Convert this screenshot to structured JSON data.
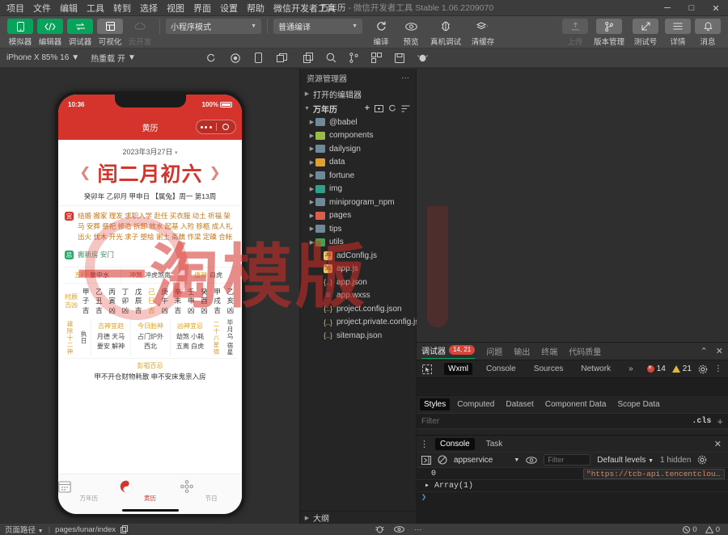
{
  "titlebar": {
    "menu": [
      "项目",
      "文件",
      "编辑",
      "工具",
      "转到",
      "选择",
      "视图",
      "界面",
      "设置",
      "帮助",
      "微信开发者工具"
    ],
    "project_name": "万年历",
    "app_name": " - 微信开发者工具 Stable 1.06.2209070",
    "minimize": "─",
    "maximize": "□",
    "close": "✕"
  },
  "toolbar": {
    "left_items": [
      {
        "label": "模拟器",
        "icon": "phone-icon",
        "state": "green"
      },
      {
        "label": "编辑器",
        "icon": "code-icon",
        "state": "green"
      },
      {
        "label": "调试器",
        "icon": "debug-icon",
        "state": "green"
      },
      {
        "label": "可视化",
        "icon": "layout-icon",
        "state": "grey"
      },
      {
        "label": "云开发",
        "icon": "cloud-icon",
        "state": "disabled"
      }
    ],
    "mode_select": "小程序模式",
    "compile_select": "普通编译",
    "actions": [
      {
        "label": "编译",
        "icon": "refresh-icon"
      },
      {
        "label": "预览",
        "icon": "eye-icon"
      },
      {
        "label": "真机调试",
        "icon": "device-debug-icon"
      },
      {
        "label": "清缓存",
        "icon": "stack-icon"
      }
    ],
    "right_actions": [
      {
        "label": "上传",
        "icon": "upload-icon",
        "disabled": true
      },
      {
        "label": "版本管理",
        "icon": "branch-icon",
        "disabled": false
      },
      {
        "label": "测试号",
        "icon": "test-icon",
        "disabled": false
      },
      {
        "label": "详情",
        "icon": "menu-icon",
        "disabled": false
      },
      {
        "label": "消息",
        "icon": "bell-icon",
        "disabled": false
      }
    ]
  },
  "subbar": {
    "device": "iPhone X 85% 16",
    "hotreload": "热重载 开",
    "icons": [
      "refresh-icon",
      "record-icon",
      "phone-icon",
      "window-icon"
    ],
    "icons2": [
      "copy-icon",
      "search-icon",
      "branch-icon",
      "extensions-icon",
      "save-icon",
      "debug-icon"
    ]
  },
  "explorer": {
    "title": "资源管理器",
    "more": "···",
    "open_editors": "打开的编辑器",
    "project": "万年历",
    "project_actions": [
      "new-file-icon",
      "new-folder-icon",
      "refresh-icon",
      "collapse-icon"
    ],
    "tree": [
      {
        "name": "@babel",
        "type": "folder",
        "color": "#6e8a9a"
      },
      {
        "name": "components",
        "type": "folder",
        "color": "#9aba4a"
      },
      {
        "name": "dailysign",
        "type": "folder",
        "color": "#6e8a9a"
      },
      {
        "name": "data",
        "type": "folder",
        "color": "#e0a030"
      },
      {
        "name": "fortune",
        "type": "folder",
        "color": "#6e8a9a"
      },
      {
        "name": "img",
        "type": "folder",
        "color": "#2fa08a"
      },
      {
        "name": "miniprogram_npm",
        "type": "folder",
        "color": "#6e8a9a"
      },
      {
        "name": "pages",
        "type": "folder",
        "color": "#d8604a"
      },
      {
        "name": "tips",
        "type": "folder",
        "color": "#6e8a9a"
      },
      {
        "name": "utils",
        "type": "folder",
        "color": "#4aa04a"
      },
      {
        "name": "adConfig.js",
        "type": "js"
      },
      {
        "name": "app.js",
        "type": "js"
      },
      {
        "name": "app.json",
        "type": "json"
      },
      {
        "name": "app.wxss",
        "type": "wxss"
      },
      {
        "name": "project.config.json",
        "type": "json"
      },
      {
        "name": "project.private.config.js...",
        "type": "json"
      },
      {
        "name": "sitemap.json",
        "type": "json"
      }
    ],
    "outline": "大纲"
  },
  "simulator": {
    "status": {
      "time": "10:36",
      "battery": "100%"
    },
    "navbar_title": "黄历",
    "date": "2023年3月27日",
    "date_caret": "▾",
    "prev_arrow": "❮",
    "next_arrow": "❯",
    "lunar_big": "闰二月初六",
    "ganzhi": "癸卯年 乙卯月 甲申日 【属兔】周一 第13周",
    "yi_badge": "宜",
    "yi_text": "结婚 搬家 理发 求职入学 赴任 买衣服 动土 祈福 架马 安葬 祭祀 修造 拆卸 放水 起基 入殓 移柩 成人礼 出火 伐木 开光 求子 塑绘 谢土 斋醮 作梁 定磉 合帐",
    "ji_badge": "忌",
    "ji_text": "搬新房 安门",
    "tri": [
      {
        "label": "五行",
        "value": "泉中水",
        "accent": "gold"
      },
      {
        "label": "冲煞",
        "value": "冲虎煞南",
        "accent": "red"
      },
      {
        "label": "值神",
        "value": "白虎",
        "accent": "gold"
      }
    ],
    "hour_label": [
      "时辰",
      "吉凶"
    ],
    "hours": [
      {
        "g": "甲",
        "z": "子",
        "r": "吉",
        "on": false
      },
      {
        "g": "乙",
        "z": "丑",
        "r": "吉",
        "on": false
      },
      {
        "g": "丙",
        "z": "寅",
        "r": "凶",
        "on": false
      },
      {
        "g": "丁",
        "z": "卯",
        "r": "凶",
        "on": false
      },
      {
        "g": "戊",
        "z": "辰",
        "r": "吉",
        "on": false
      },
      {
        "g": "己",
        "z": "巳",
        "r": "吉",
        "on": true
      },
      {
        "g": "庚",
        "z": "午",
        "r": "凶",
        "on": false
      },
      {
        "g": "辛",
        "z": "未",
        "r": "吉",
        "on": false
      },
      {
        "g": "壬",
        "z": "申",
        "r": "凶",
        "on": false
      },
      {
        "g": "癸",
        "z": "酉",
        "r": "凶",
        "on": false
      },
      {
        "g": "甲",
        "z": "戌",
        "r": "吉",
        "on": false
      },
      {
        "g": "乙",
        "z": "亥",
        "r": "凶",
        "on": false
      }
    ],
    "left_vlabel": "建除十二神",
    "left_vvalue": "执日",
    "gods": [
      {
        "title": "吉神宜趋",
        "body": "月德  天马\n要安  解神"
      },
      {
        "title": "今日胎神",
        "body": "占门炉外\n西北"
      },
      {
        "title": "凶神宜忌",
        "body": "劫煞  小耗\n五离  白虎"
      }
    ],
    "right_vlabel": "二十八星宿",
    "right_vvalue": "毕月乌 宿星",
    "pengzu_title": "彭祖百忌",
    "pengzu_body": "甲不开仓财物耗散 申不安床鬼祟入房",
    "tabs": [
      {
        "label": "万年历",
        "icon": "calendar-icon",
        "active": false
      },
      {
        "label": "黄历",
        "icon": "yinyang-icon",
        "active": true
      },
      {
        "label": "节日",
        "icon": "festival-icon",
        "active": false
      }
    ]
  },
  "devtools": {
    "tabs": [
      {
        "label": "调试器",
        "badge": "14, 21",
        "active": true
      },
      {
        "label": "问题",
        "active": false
      },
      {
        "label": "输出",
        "active": false
      },
      {
        "label": "终端",
        "active": false
      },
      {
        "label": "代码质量",
        "active": false
      }
    ],
    "collapse": "⌃",
    "close": "✕",
    "panel_tabs": [
      "Wxml",
      "Console",
      "Sources",
      "Network"
    ],
    "panel_active": "Wxml",
    "overflow": "»",
    "errors": "14",
    "warnings": "21",
    "style_tabs": [
      "Styles",
      "Computed",
      "Dataset",
      "Component Data",
      "Scope Data"
    ],
    "style_active": "Styles",
    "filter_placeholder": "Filter",
    "cls": ".cls",
    "add": "+",
    "console": {
      "tabs": [
        "Console",
        "Task"
      ],
      "active": "Console",
      "close": "✕",
      "context": "appservice",
      "filter_placeholder": "Filter",
      "levels": "Default levels",
      "hidden": "1 hidden",
      "rows": [
        {
          "index": "0",
          "value": "\"https://tcb-api.tencentcloudap…\""
        },
        {
          "index": "▸ Array(1)",
          "value": ""
        }
      ],
      "prompt": "❯"
    }
  },
  "statusbar": {
    "page_path_label": "页面路径",
    "page_path": "pages/lunar/index",
    "copy_icon": "copy-icon",
    "icons": [
      "bug-icon",
      "eye-icon",
      "more-icon"
    ],
    "errors": "0",
    "warnings": "0"
  },
  "watermark": {
    "text": "一淘模版"
  },
  "colors": {
    "accent_green": "#07a35a",
    "brand_red": "#d4342c",
    "gold": "#e0a020",
    "error_red": "#d8453c",
    "warn_yellow": "#e0b83c"
  }
}
